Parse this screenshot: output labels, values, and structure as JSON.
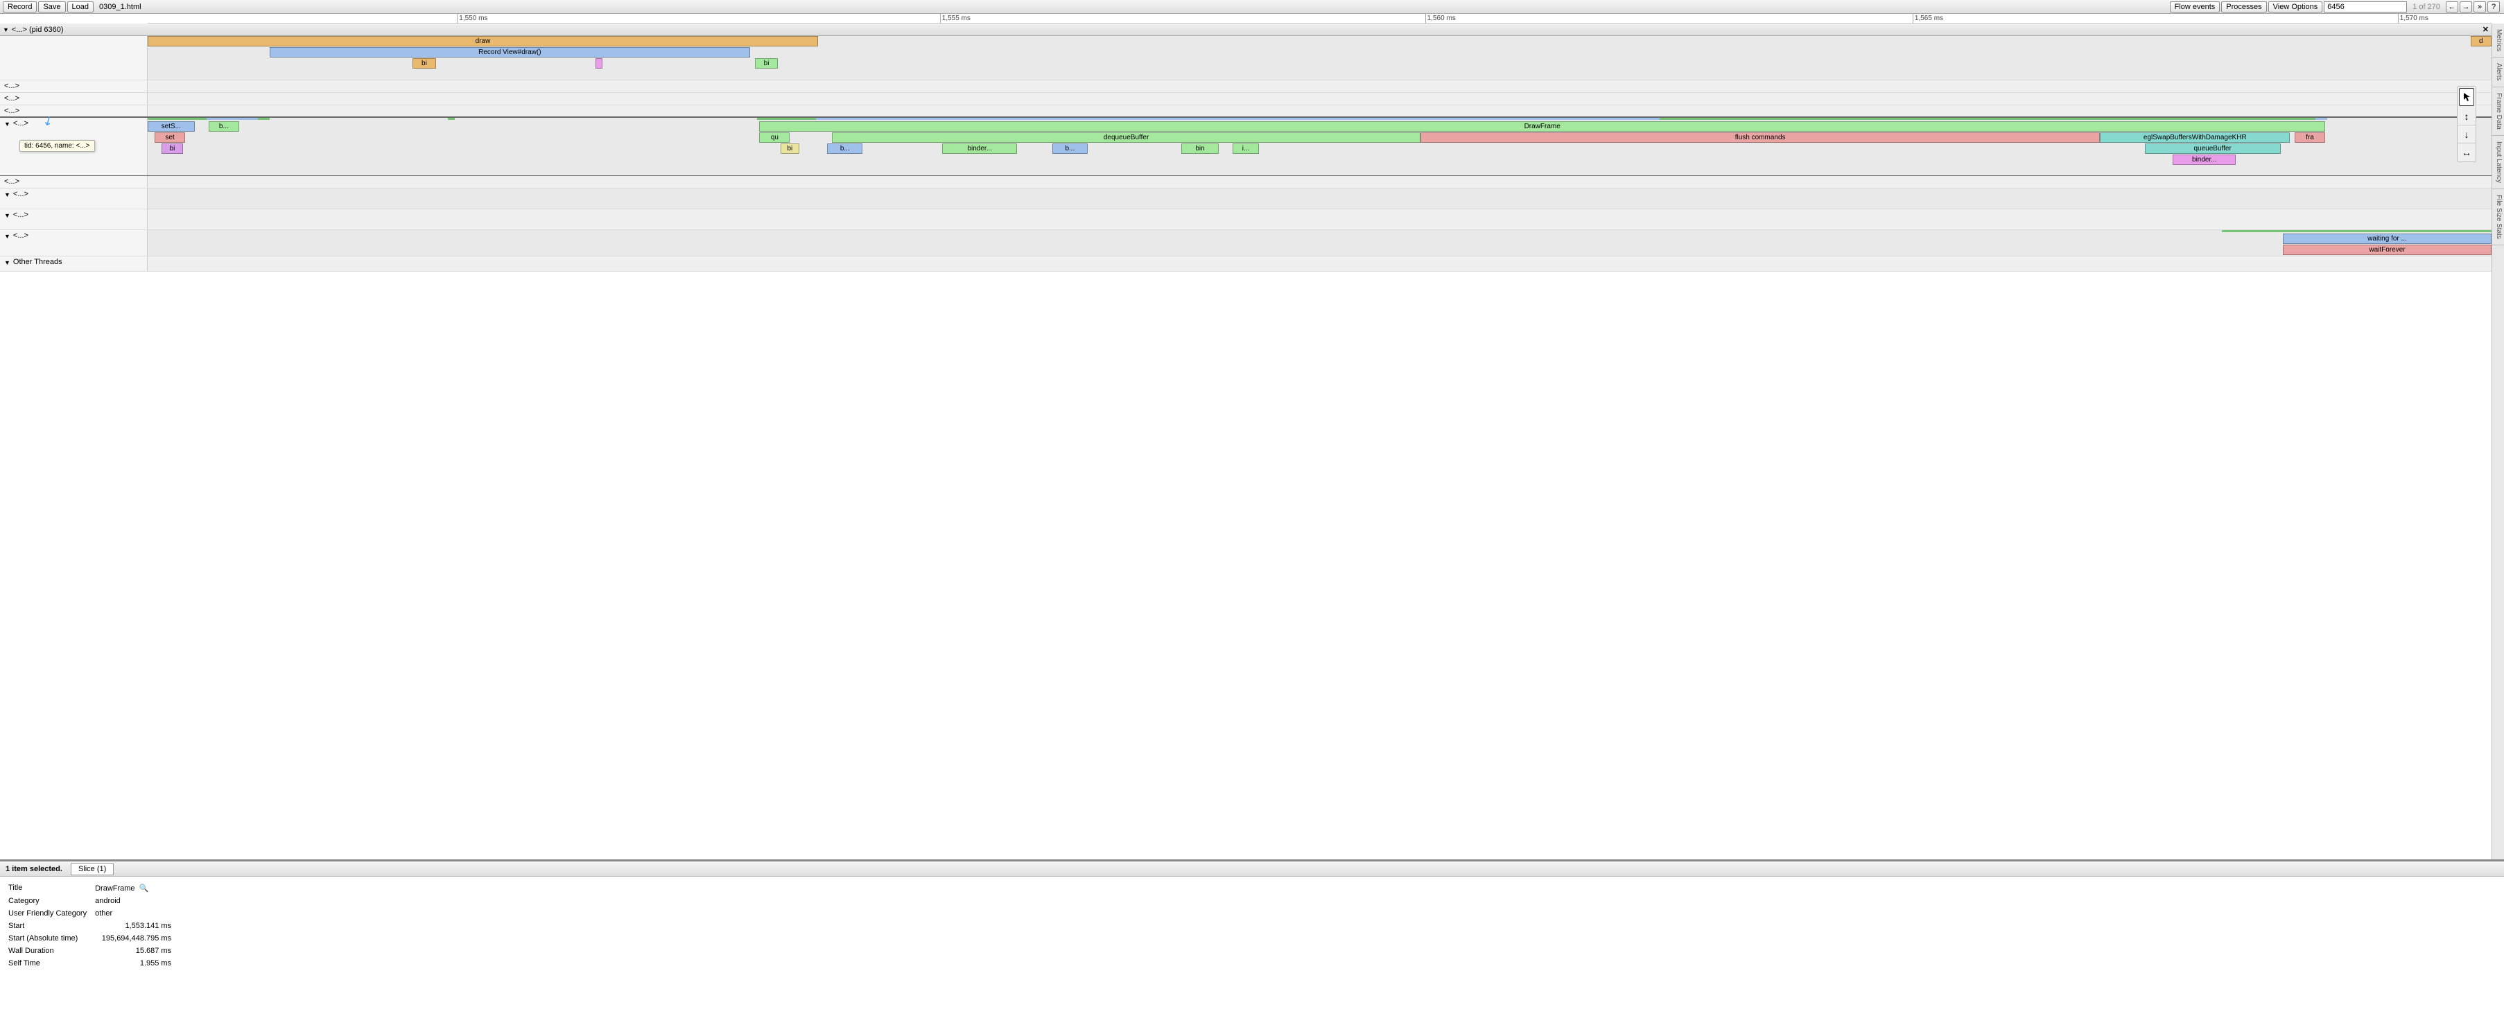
{
  "toolbar": {
    "record": "Record",
    "save": "Save",
    "load": "Load",
    "filename": "0309_1.html",
    "flow_events": "Flow events",
    "processes": "Processes",
    "view_options": "View Options",
    "search_value": "6456",
    "search_count": "1 of 270",
    "help": "?"
  },
  "ruler": {
    "ticks": [
      "1,550 ms",
      "1,555 ms",
      "1,560 ms",
      "1,565 ms",
      "1,570 ms"
    ]
  },
  "right_tabs": [
    "Metrics",
    "Alerts",
    "Frame Data",
    "Input Latency",
    "File Size Stats"
  ],
  "process_header": "<...> (pid 6360)",
  "tooltip": "tid: 6456, name: <...>",
  "tracks": {
    "t1": {
      "slices": {
        "draw": "draw",
        "record_view": "Record View#draw()",
        "bi1": "bi",
        "bi2": "bi",
        "d": "d"
      }
    },
    "t2_label": "<...>",
    "t3_label": "<...>",
    "t4_label": "<...>",
    "t5": {
      "label": "<...>",
      "slices": {
        "sets": "setS...",
        "b": "b...",
        "set": "set",
        "bi": "bi",
        "qu": "qu",
        "drawframe": "DrawFrame",
        "dequeue": "dequeueBuffer",
        "flush": "flush commands",
        "egl": "eglSwapBuffersWithDamageKHR",
        "fra": "fra",
        "bi2": "bi",
        "b2": "b...",
        "binder": "binder...",
        "b3": "b...",
        "bin": "bin",
        "i": "i...",
        "queue": "queueBuffer",
        "binder2": "binder..."
      }
    },
    "t6_label": "<...>",
    "t7_label": "<...>",
    "t8_label": "<...>",
    "t9": {
      "label": "<...>",
      "slices": {
        "waiting": "waiting for ...",
        "waitforever": "waitForever"
      }
    },
    "other_threads": "Other Threads"
  },
  "details": {
    "selected_label": "1 item selected.",
    "tab": "Slice (1)",
    "rows": {
      "title_k": "Title",
      "title_v": "DrawFrame",
      "category_k": "Category",
      "category_v": "android",
      "ufc_k": "User Friendly Category",
      "ufc_v": "other",
      "start_k": "Start",
      "start_v": "1,553.141 ms",
      "start_abs_k": "Start (Absolute time)",
      "start_abs_v": "195,694,448.795 ms",
      "wall_k": "Wall Duration",
      "wall_v": "15.687 ms",
      "self_k": "Self Time",
      "self_v": "1.955 ms"
    }
  }
}
